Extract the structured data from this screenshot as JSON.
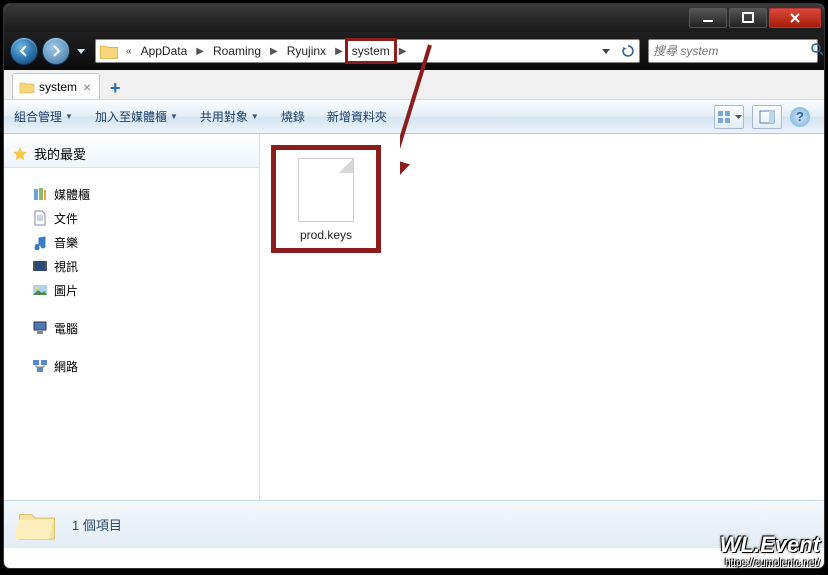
{
  "breadcrumb": {
    "items": [
      "AppData",
      "Roaming",
      "Ryujinx",
      "system"
    ],
    "highlight_index": 3
  },
  "search": {
    "placeholder": "搜尋 system"
  },
  "tab": {
    "label": "system"
  },
  "toolbar": {
    "organize": "組合管理",
    "include": "加入至媒體櫃",
    "share": "共用對象",
    "burn": "燒錄",
    "newfolder": "新增資料夾"
  },
  "sidebar": {
    "favorites": {
      "label": "我的最愛"
    },
    "libraries": {
      "label": "媒體櫃",
      "items": [
        "文件",
        "音樂",
        "視訊",
        "圖片"
      ]
    },
    "computer": {
      "label": "電腦"
    },
    "network": {
      "label": "網路"
    }
  },
  "file": {
    "name": "prod.keys"
  },
  "status": {
    "text": "1 個項目"
  },
  "watermark": {
    "line1": "WL.Event",
    "line2": "https://cumolentc.net/"
  }
}
